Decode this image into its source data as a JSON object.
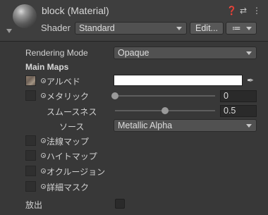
{
  "header": {
    "title": "block (Material)",
    "shader_label": "Shader",
    "shader_value": "Standard",
    "edit_button": "Edit...",
    "list_button": "≔",
    "icons": [
      "help-icon",
      "settings-sliders-icon",
      "more-icon"
    ]
  },
  "main": {
    "rendering_mode_label": "Rendering Mode",
    "rendering_mode_value": "Opaque",
    "main_maps_heading": "Main Maps",
    "albedo_label": "アルベド",
    "metallic_label": "メタリック",
    "metallic_value": "0",
    "metallic_fraction": 0.0,
    "smoothness_label": "スムースネス",
    "smoothness_value": "0.5",
    "smoothness_fraction": 0.5,
    "source_label": "ソース",
    "source_value": "Metallic Alpha",
    "normal_map_label": "法線マップ",
    "height_map_label": "ハイトマップ",
    "occlusion_label": "オクルージョン",
    "detail_mask_label": "詳細マスク",
    "emission_label": "放出"
  },
  "colors": {
    "background": "#383838",
    "header": "#3e3e3e",
    "albedo_color": "#ffffff"
  }
}
